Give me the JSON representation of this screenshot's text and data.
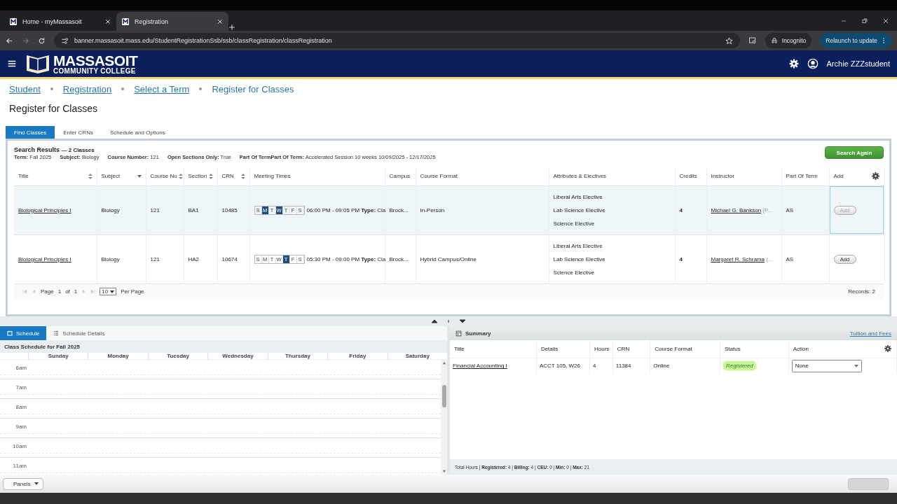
{
  "browser": {
    "tabs": [
      {
        "title": "Home - myMassasoit",
        "selected": false
      },
      {
        "title": "Registration",
        "selected": true
      }
    ],
    "url": "banner.massasoit.mass.edu/StudentRegistrationSsb/ssb/classRegistration/classRegistration",
    "incognito": "Incognito",
    "relaunch": "Relaunch to update"
  },
  "header": {
    "logo_title": "MASSASOIT",
    "logo_subtitle": "COMMUNITY COLLEGE",
    "user": "Archie ZZZstudent"
  },
  "breadcrumb": [
    {
      "label": "Student",
      "link": true
    },
    {
      "label": "Registration",
      "link": true
    },
    {
      "label": "Select a Term",
      "link": true
    },
    {
      "label": "Register for Classes",
      "link": false
    }
  ],
  "page_title": "Register for Classes",
  "tabs": [
    {
      "label": "Find Classes",
      "selected": true
    },
    {
      "label": "Enter CRNs",
      "selected": false
    },
    {
      "label": "Schedule and Options",
      "selected": false
    }
  ],
  "search_results": {
    "heading": "Search Results",
    "count": "— 2 Classes",
    "search_again": "Search Again",
    "records": "Records: 2",
    "criteria": [
      "**Term:** Fall 2025",
      "**Subject:** Biology",
      "**Course Number:** 121",
      "**Open Sections Only:** True",
      "**Part Of TermPart Of Term:** Accelerated Session 10 weeks 10/09/2025 - 12/17/2025"
    ],
    "columns": [
      {
        "label": "Title",
        "sortable": true,
        "menu": false
      },
      {
        "label": "Subject",
        "sortable": false,
        "menu": true
      },
      {
        "label": "Course Nu",
        "sortable": true,
        "menu": false
      },
      {
        "label": "Section",
        "sortable": true,
        "menu": false
      },
      {
        "label": "CRN",
        "sortable": true,
        "menu": false
      },
      {
        "label": "Meeting Times",
        "sortable": false,
        "menu": false
      },
      {
        "label": "Campus",
        "sortable": false,
        "menu": false
      },
      {
        "label": "Course Format",
        "sortable": false,
        "menu": false
      },
      {
        "label": "Attributes & Electives",
        "sortable": false,
        "menu": false
      },
      {
        "label": "Credits",
        "sortable": false,
        "menu": false
      },
      {
        "label": "Instructor",
        "sortable": false,
        "menu": false
      },
      {
        "label": "Part Of Term",
        "sortable": false,
        "menu": false
      },
      {
        "label": "Add",
        "sortable": false,
        "menu": false
      }
    ],
    "rows": [
      {
        "selected": true,
        "title": "Biological Principles I",
        "subject": "Biology",
        "course": "121",
        "section": "BA1",
        "crn": "10485",
        "days": [
          {
            "letter": "S",
            "on": false
          },
          {
            "letter": "M",
            "on": true
          },
          {
            "letter": "T",
            "on": false
          },
          {
            "letter": "W",
            "on": true
          },
          {
            "letter": "T",
            "on": false
          },
          {
            "letter": "F",
            "on": false
          },
          {
            "letter": "S",
            "on": false
          }
        ],
        "time": "06:00 PM - 09:05 PM **Type:** Cla",
        "campus": "Brock...",
        "format": "In-Person",
        "attributes": [
          "Liberal Arts Elective",
          "Lab Science Elective",
          "Science Elective"
        ],
        "credits": "4",
        "instructor": "Michael G. Bankson",
        "instructor_note": "(P...",
        "part_of_term": "AS",
        "add": {
          "label": "Add",
          "disabled": true,
          "focused": true
        }
      },
      {
        "selected": false,
        "title": "Biological Principles I",
        "subject": "Biology",
        "course": "121",
        "section": "HA2",
        "crn": "10674",
        "days": [
          {
            "letter": "S",
            "on": false
          },
          {
            "letter": "M",
            "on": false
          },
          {
            "letter": "T",
            "on": false
          },
          {
            "letter": "W",
            "on": false
          },
          {
            "letter": "T",
            "on": true
          },
          {
            "letter": "F",
            "on": false
          },
          {
            "letter": "S",
            "on": false
          }
        ],
        "time": "05:30 PM - 09:00 PM **Type:** Cla",
        "campus": "Brock...",
        "format": "Hybrid Campus/Online",
        "attributes": [
          "Liberal Arts Elective",
          "Lab Science Elective",
          "Science Elective"
        ],
        "credits": "4",
        "instructor": "Margaret R. Schrama",
        "instructor_note": "(...",
        "part_of_term": "AS",
        "add": {
          "label": "Add",
          "disabled": false,
          "focused": false
        }
      }
    ],
    "pager": {
      "page_label": "Page",
      "page": "1",
      "of": "of",
      "total": "1",
      "per_page_value": "10",
      "per_page_label": "Per Page"
    }
  },
  "schedule": {
    "tabs": [
      {
        "label": "Schedule",
        "selected": true
      },
      {
        "label": "Schedule Details",
        "selected": false
      }
    ],
    "caption": "Class Schedule for Fall 2025",
    "days": [
      "Sunday",
      "Monday",
      "Tuesday",
      "Wednesday",
      "Thursday",
      "Friday",
      "Saturday"
    ],
    "hours": [
      "6am",
      "7am",
      "8am",
      "9am",
      "10am",
      "11am"
    ]
  },
  "summary": {
    "title": "Summary",
    "link": "Tuition and Fees",
    "columns": [
      "Title",
      "Details",
      "Hours",
      "CRN",
      "Course Format",
      "Status",
      "Action"
    ],
    "rows": [
      {
        "title": "Financial Accounting I",
        "details": "ACCT 105, W26",
        "hours": "4",
        "crn": "11384",
        "format": "Online",
        "status": "Registered",
        "action": "None"
      }
    ],
    "totals": "Total Hours | **Registered:** 4 | **Billing:** 4 | **CEU:** 0 | **Min:** 0 | **Max:** 21"
  },
  "footer": {
    "panels": "Panels"
  }
}
